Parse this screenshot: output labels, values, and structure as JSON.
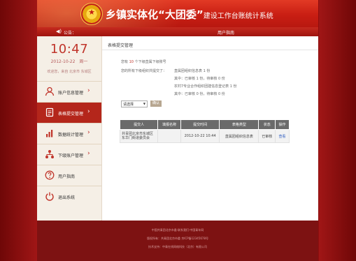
{
  "header": {
    "title_main": "乡镇实体化“大团委”",
    "title_sub": "建设工作台账统计系统",
    "notice_label": "公告：",
    "notice_center": "用户指南"
  },
  "clock": {
    "time": "10:47",
    "date": "2012-10-22　周一",
    "greeting": "欢迎您，来自 北京市 东城区"
  },
  "menu": [
    {
      "label": "账户信息管理",
      "icon": "user-icon",
      "active": false
    },
    {
      "label": "表格提交管理",
      "icon": "document-icon",
      "active": true
    },
    {
      "label": "数据统计管理",
      "icon": "bar-chart-icon",
      "active": false
    },
    {
      "label": "下级账户管理",
      "icon": "org-tree-icon",
      "active": false
    },
    {
      "label": "用户指南",
      "icon": "help-icon",
      "active": false
    },
    {
      "label": "退出系统",
      "icon": "power-icon",
      "active": false
    }
  ],
  "content": {
    "breadcrumb": "表格提交管理",
    "summary_prefix": "您有",
    "summary_count": "10",
    "summary_suffix": "个下级直属下级账号",
    "received_label": "您的所有下级组织共提交了：",
    "line1": "直属团组织信息表 1 份",
    "line2": "其中：已审核 1 份，待审核 0 份",
    "line3": "农村7专业合作组织团建信息登记表 1 份",
    "line4": "其中：已审核 0 份，待审核 0 份",
    "select_value": "请选择",
    "query_button": "确认"
  },
  "table": {
    "headers": [
      "提交人",
      "填报名称",
      "提交时间",
      "表格类型",
      "状态",
      "操作"
    ],
    "rows": [
      {
        "submitter": "共青团北京市东城区东华门街道委员会",
        "name": "",
        "time": "2012-10-22 10:44",
        "type": "直属团组织信息表",
        "status": "已审核",
        "action": "查看"
      }
    ]
  },
  "footer": {
    "line1": "中国共青团北京市委·联系我们·中国青年网",
    "line2": "版权所有：共青团北京市委 京ICP备12345678号",
    "line3": "技术支持：中青在线网络科技（北京）有限公司"
  },
  "colors": {
    "brand_red": "#c91e13",
    "active_menu": "#b4261b",
    "link": "#2c5bbf"
  }
}
